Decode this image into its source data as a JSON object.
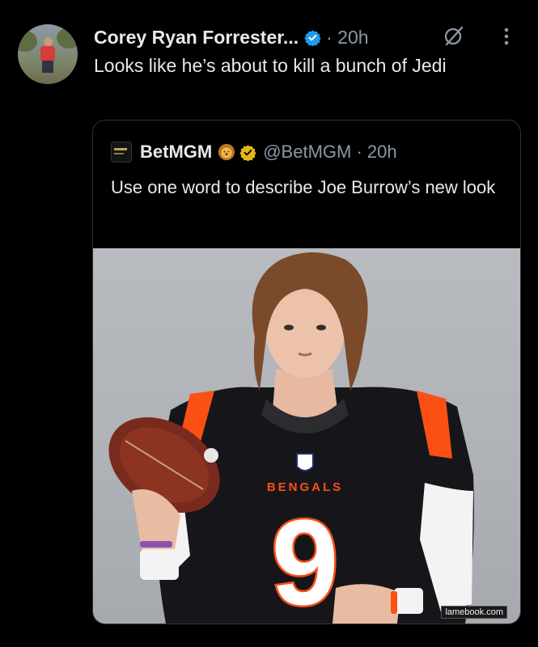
{
  "tweet": {
    "author_name": "Corey Ryan Forrester...",
    "time": "· 20h",
    "text": "Looks like he’s about to kill a bunch of Jedi"
  },
  "quoted": {
    "author_name": "BetMGM",
    "handle_time": "@BetMGM · 20h",
    "text": "Use one word to describe Joe Burrow’s new look",
    "avatar_label": "BETMGM",
    "photo": {
      "jersey_text": "BENGALS",
      "jersey_number": "9",
      "watermark": "lamebook.com"
    }
  },
  "icons": [
    "verified-badge-icon",
    "grok-icon",
    "more-options-icon",
    "lion-emoji-icon",
    "gold-verified-badge-icon"
  ],
  "colors": {
    "background": "#000000",
    "text": "#e7e9ea",
    "muted": "#8b98a5",
    "verified_blue": "#1d9bf0",
    "verified_gold": "#e2b719",
    "bengals_orange": "#fb4f14"
  }
}
